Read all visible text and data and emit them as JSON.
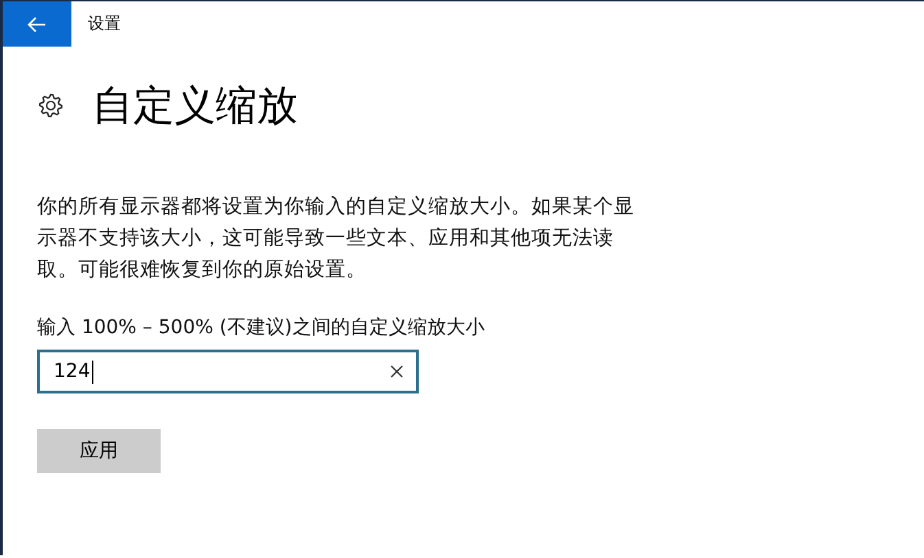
{
  "window": {
    "title": "设置"
  },
  "page": {
    "heading": "自定义缩放",
    "description": "你的所有显示器都将设置为你输入的自定义缩放大小。如果某个显示器不支持该大小，这可能导致一些文本、应用和其他项无法读取。可能很难恢复到你的原始设置。"
  },
  "scale_field": {
    "label": "输入 100% – 500% (不建议)之间的自定义缩放大小",
    "value": "124",
    "focused": true
  },
  "buttons": [
    "应用"
  ]
}
